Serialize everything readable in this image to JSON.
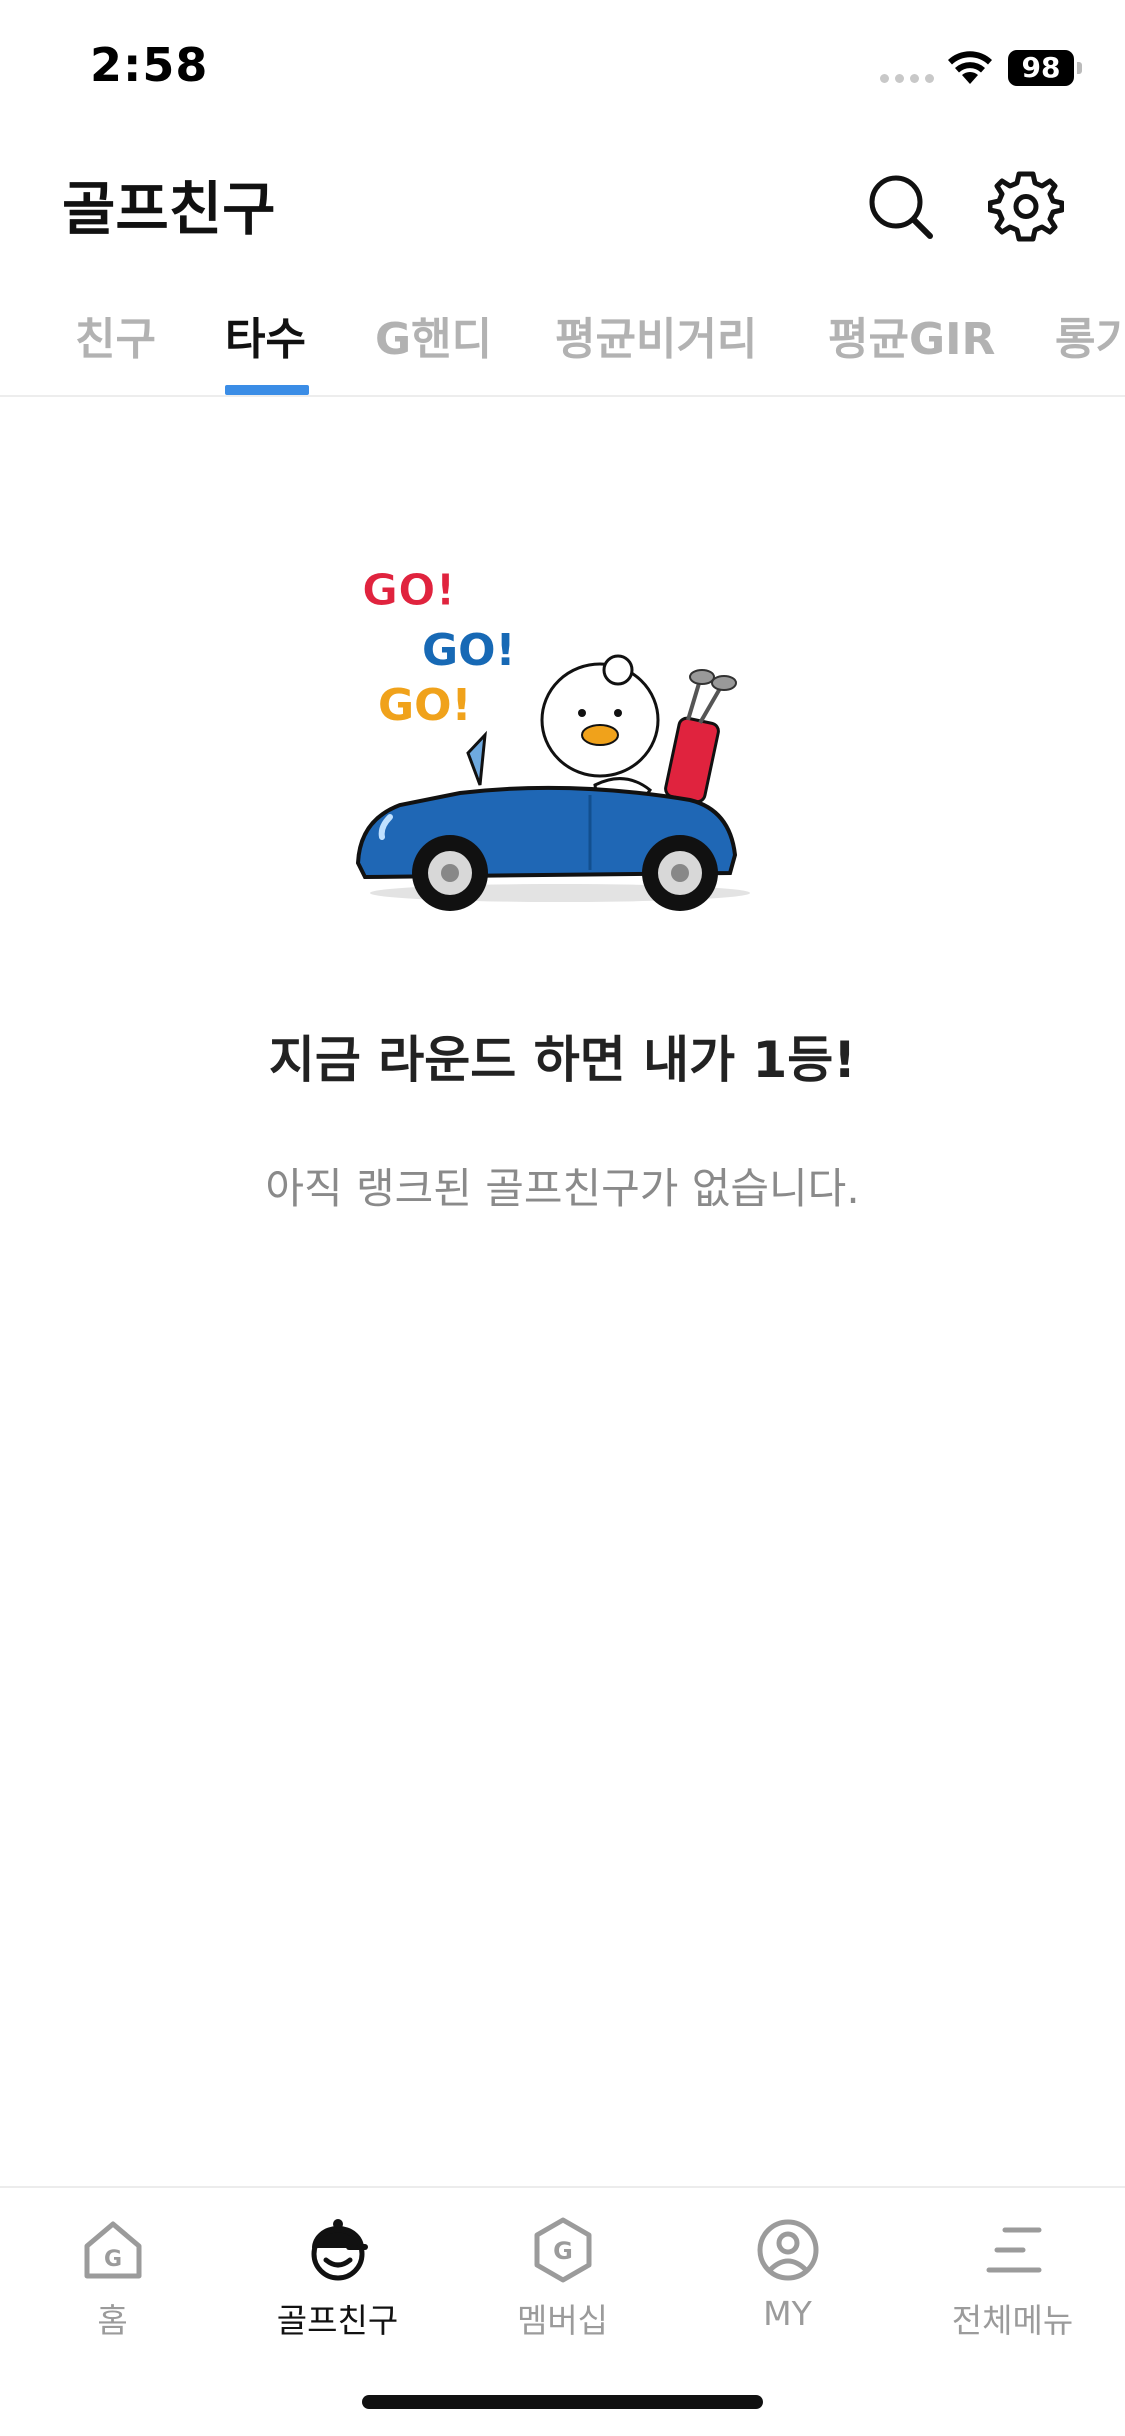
{
  "status_bar": {
    "time": "2:58",
    "battery": "98"
  },
  "header": {
    "title": "골프친구"
  },
  "tabs": [
    {
      "label": "친구"
    },
    {
      "label": "타수"
    },
    {
      "label": "G핸디"
    },
    {
      "label": "평균비거리"
    },
    {
      "label": "평균GIR"
    },
    {
      "label": "롱기"
    }
  ],
  "active_tab": "타수",
  "illustration": {
    "go_lines": [
      "GO!",
      "GO!",
      "GO!"
    ]
  },
  "empty_state": {
    "title": "지금 라운드 하면 내가 1등!",
    "description": "아직 랭크된 골프친구가 없습니다."
  },
  "bottom_nav": [
    {
      "label": "홈",
      "icon": "home-icon"
    },
    {
      "label": "골프친구",
      "icon": "golf-friend-icon"
    },
    {
      "label": "멤버십",
      "icon": "membership-icon"
    },
    {
      "label": "MY",
      "icon": "profile-icon"
    },
    {
      "label": "전체메뉴",
      "icon": "menu-icon"
    }
  ],
  "active_nav": "골프친구",
  "colors": {
    "accent": "#3b8de6",
    "go_red": "#e0233e",
    "go_blue": "#1769b5",
    "go_yellow": "#f0a21b",
    "car_blue": "#1f67b5"
  }
}
